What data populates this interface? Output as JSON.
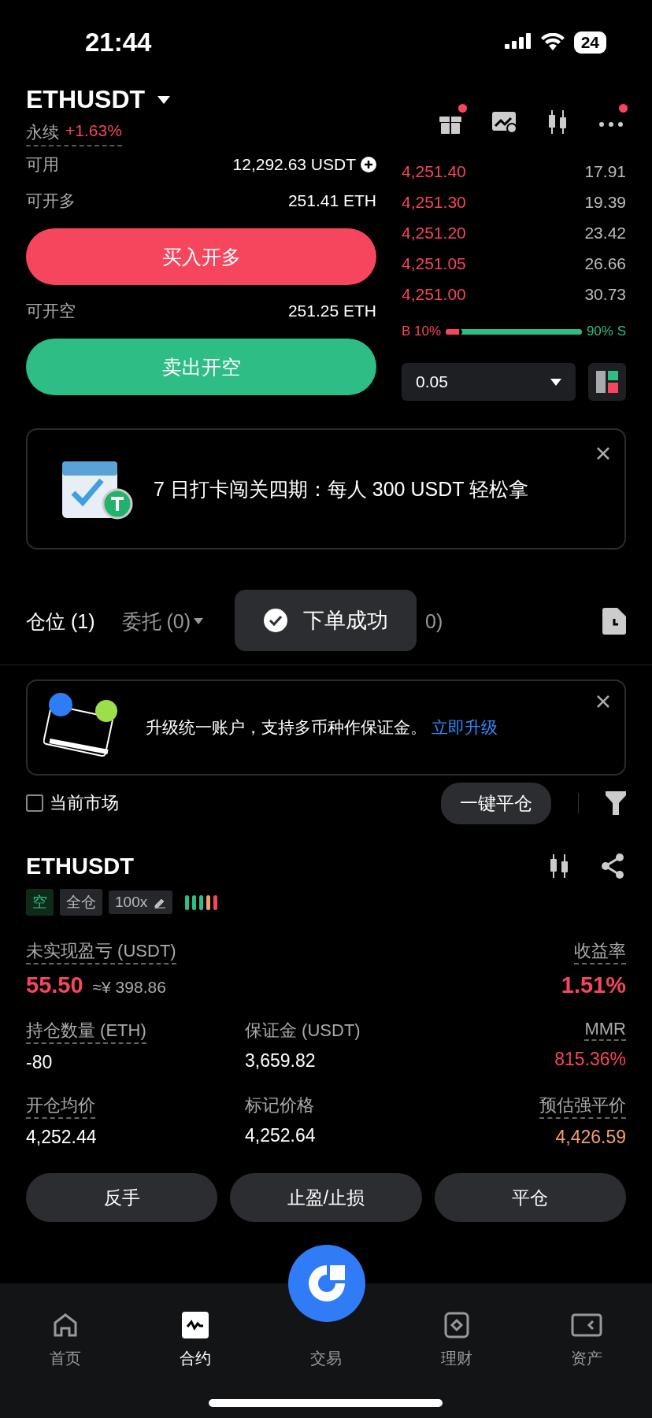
{
  "status_bar": {
    "time": "21:44",
    "battery": "24"
  },
  "header": {
    "symbol": "ETHUSDT",
    "type": "永续",
    "change": "+1.63%",
    "actions": [
      {
        "kind": "gift",
        "badge": true
      },
      {
        "kind": "chart",
        "badge": false
      },
      {
        "kind": "candles",
        "badge": false
      },
      {
        "kind": "more",
        "badge": true
      }
    ]
  },
  "order_form": {
    "rows": [
      {
        "label": "可用",
        "value": "12,292.63 USDT",
        "add": true
      },
      {
        "label": "可开多",
        "value": "251.41 ETH",
        "add": false
      }
    ],
    "buy_button": "买入开多",
    "short_row": {
      "label": "可开空",
      "value": "251.25 ETH"
    },
    "sell_button": "卖出开空"
  },
  "order_book": {
    "asks": [
      {
        "price": "4,251.40",
        "amount": "17.91"
      },
      {
        "price": "4,251.30",
        "amount": "19.39"
      },
      {
        "price": "4,251.20",
        "amount": "23.42"
      },
      {
        "price": "4,251.05",
        "amount": "26.66"
      },
      {
        "price": "4,251.00",
        "amount": "30.73"
      }
    ],
    "buy_label": "B 10%",
    "sell_label": "90% S",
    "level": 0.1,
    "precision": "0.05"
  },
  "promo_banner": {
    "text": "7 日打卡闯关四期：每人 300 USDT 轻松拿"
  },
  "tabs": [
    {
      "label": "仓位 (1)",
      "selected": true,
      "dropdown": false
    },
    {
      "label": "委托 (0)",
      "selected": false,
      "dropdown": true
    },
    {
      "label": "0)",
      "selected": false,
      "dropdown": false
    }
  ],
  "toast": {
    "text": "下单成功"
  },
  "upgrade_banner": {
    "text": "升级统一账户，支持多币种作保证金。",
    "link": "立即升级"
  },
  "filters": {
    "current_market": {
      "label": "当前市场",
      "checked": false
    },
    "close_all": "一键平仓"
  },
  "position": {
    "symbol": "ETHUSDT",
    "tags": [
      {
        "kind": "side",
        "label": "空"
      },
      {
        "kind": "mode",
        "label": "全仓"
      },
      {
        "kind": "leverage",
        "label": "100x"
      }
    ],
    "risk_bars": [
      {
        "color": "#2ebd85"
      },
      {
        "color": "#2ebd85"
      },
      {
        "color": "#2ebd85"
      },
      {
        "color": "#f0a070"
      },
      {
        "color": "#f6465d"
      }
    ],
    "pnl": {
      "label": "未实现盈亏 (USDT)",
      "value": "55.50",
      "approx": "≈¥ 398.86",
      "rate_label": "收益率",
      "rate": "1.51%"
    },
    "fields": [
      {
        "label": "持仓数量 (ETH)",
        "value": "-80",
        "dotted": true,
        "color": "#ffffff"
      },
      {
        "label": "保证金 (USDT)",
        "value": "3,659.82",
        "dotted": false,
        "color": "#ffffff"
      },
      {
        "label": "MMR",
        "value": "815.36%",
        "dotted": true,
        "color": "#f6465d"
      },
      {
        "label": "开仓均价",
        "value": "4,252.44",
        "dotted": true,
        "color": "#ffffff"
      },
      {
        "label": "标记价格",
        "value": "4,252.64",
        "dotted": false,
        "color": "#ffffff"
      },
      {
        "label": "预估强平价",
        "value": "4,426.59",
        "dotted": true,
        "color": "#f0a070"
      }
    ],
    "buttons": [
      "反手",
      "止盈/止损",
      "平仓"
    ]
  },
  "bottom_nav": [
    {
      "kind": "home",
      "label": "首页",
      "selected": false
    },
    {
      "kind": "futures",
      "label": "合约",
      "selected": true
    },
    {
      "kind": "trade",
      "label": "交易",
      "selected": false
    },
    {
      "kind": "earn",
      "label": "理财",
      "selected": false
    },
    {
      "kind": "assets",
      "label": "资产",
      "selected": false
    }
  ]
}
